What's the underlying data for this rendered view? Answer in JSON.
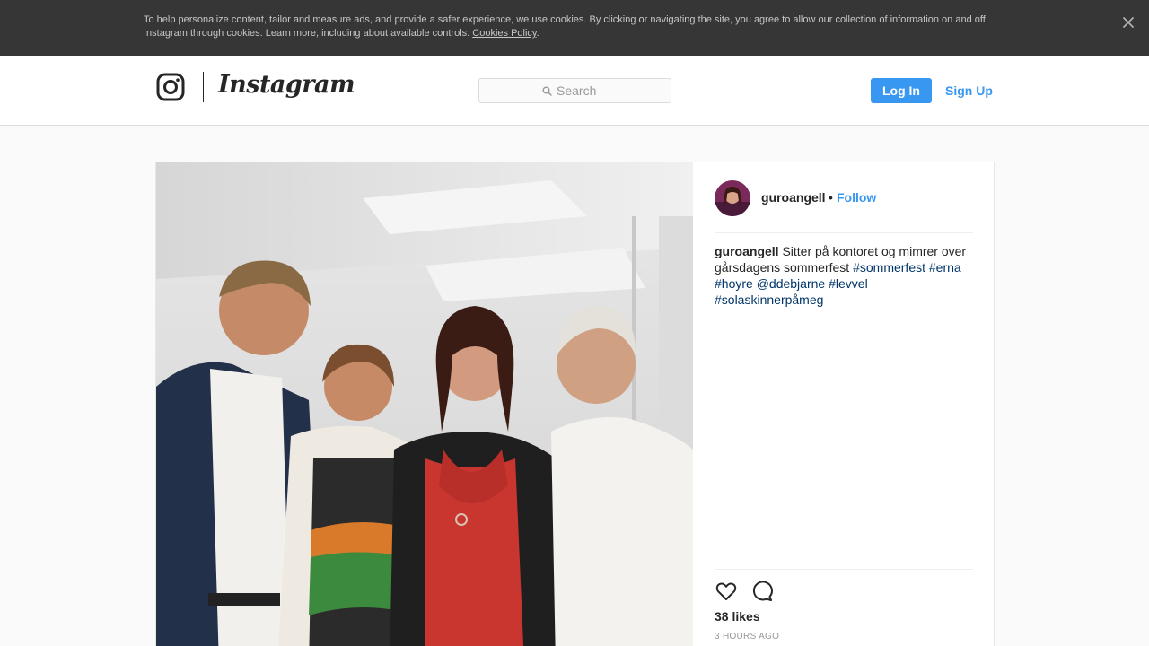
{
  "cookie_banner": {
    "text": "To help personalize content, tailor and measure ads, and provide a safer experience, we use cookies. By clicking or navigating the site, you agree to allow our collection of information on and off Instagram through cookies. Learn more, including about available controls: ",
    "link": "Cookies Policy",
    "suffix": ".",
    "close_icon": "close-icon"
  },
  "header": {
    "logo_icon": "instagram-glyph-icon",
    "logo_text": "Instagram",
    "search": {
      "placeholder": "Search",
      "icon": "search-icon"
    },
    "login_label": "Log In",
    "signup_label": "Sign Up"
  },
  "post": {
    "username": "guroangell",
    "separator": "•",
    "follow_label": "Follow",
    "caption": {
      "username": "guroangell",
      "text": " Sitter på kontoret og mimrer over gårsdagens sommerfest ",
      "tags": [
        "#sommerfest",
        "#erna",
        "#hoyre",
        "@ddebjarne",
        "#levvel",
        "#solaskinnerpåmeg"
      ]
    },
    "actions": {
      "like_icon": "heart-icon",
      "comment_icon": "comment-icon"
    },
    "likes": "38 likes",
    "time": "3 HOURS AGO"
  },
  "colors": {
    "accent": "#3897f0",
    "hashtag": "#003569",
    "banner_bg": "#363636"
  }
}
